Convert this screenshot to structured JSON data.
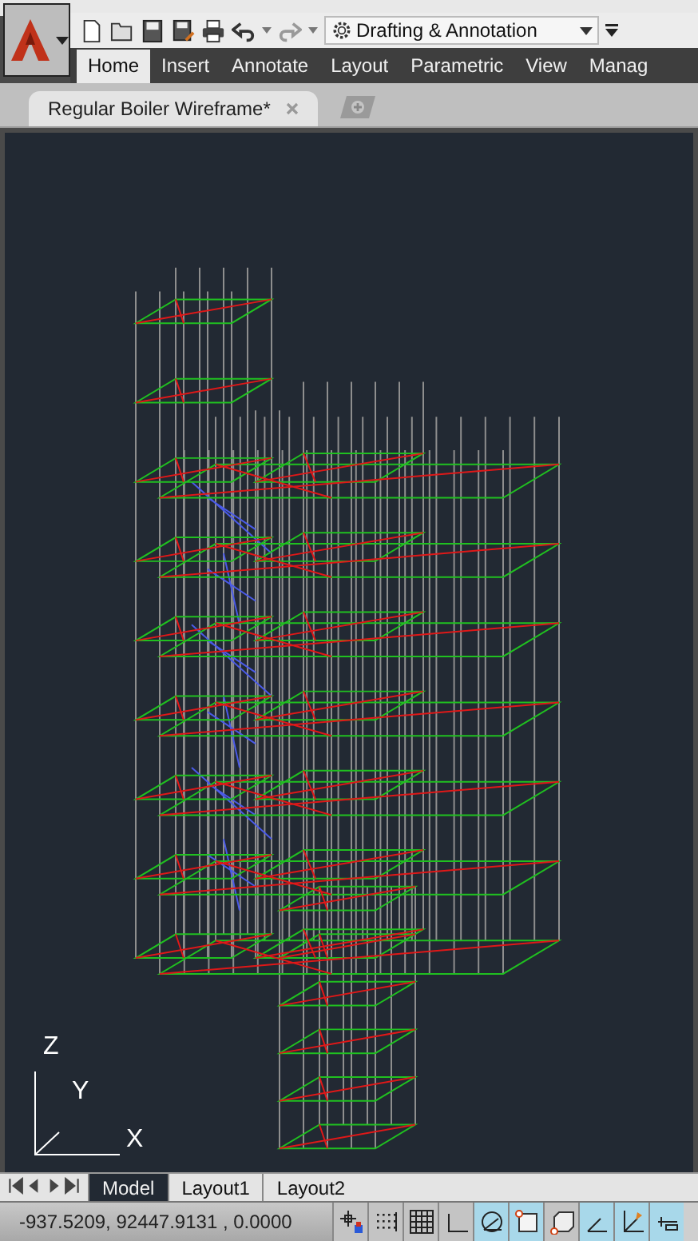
{
  "workspace": {
    "label": "Drafting & Annotation"
  },
  "ribbon_tabs": [
    {
      "label": "Home",
      "selected": true
    },
    {
      "label": "Insert",
      "selected": false
    },
    {
      "label": "Annotate",
      "selected": false
    },
    {
      "label": "Layout",
      "selected": false
    },
    {
      "label": "Parametric",
      "selected": false
    },
    {
      "label": "View",
      "selected": false
    },
    {
      "label": "Manag",
      "selected": false
    }
  ],
  "document_tabs": [
    {
      "label": "Regular Boiler Wireframe*",
      "selected": true
    }
  ],
  "ucs": {
    "z": "Z",
    "y": "Y",
    "x": "X"
  },
  "layout_tabs": [
    {
      "label": "Model",
      "selected": true
    },
    {
      "label": "Layout1",
      "selected": false
    },
    {
      "label": "Layout2",
      "selected": false
    }
  ],
  "status_bar": {
    "coordinates": "-937.5209,  92447.9131 , 0.0000",
    "toggles": [
      {
        "kind": "infer",
        "on": false
      },
      {
        "kind": "snap",
        "on": false
      },
      {
        "kind": "grid",
        "on": false
      },
      {
        "kind": "ortho",
        "on": false
      },
      {
        "kind": "polar",
        "on": true
      },
      {
        "kind": "osnap",
        "on": true
      },
      {
        "kind": "osnap3d",
        "on": false
      },
      {
        "kind": "otrack",
        "on": true
      },
      {
        "kind": "ducs",
        "on": true
      },
      {
        "kind": "dyn",
        "on": true
      }
    ]
  }
}
